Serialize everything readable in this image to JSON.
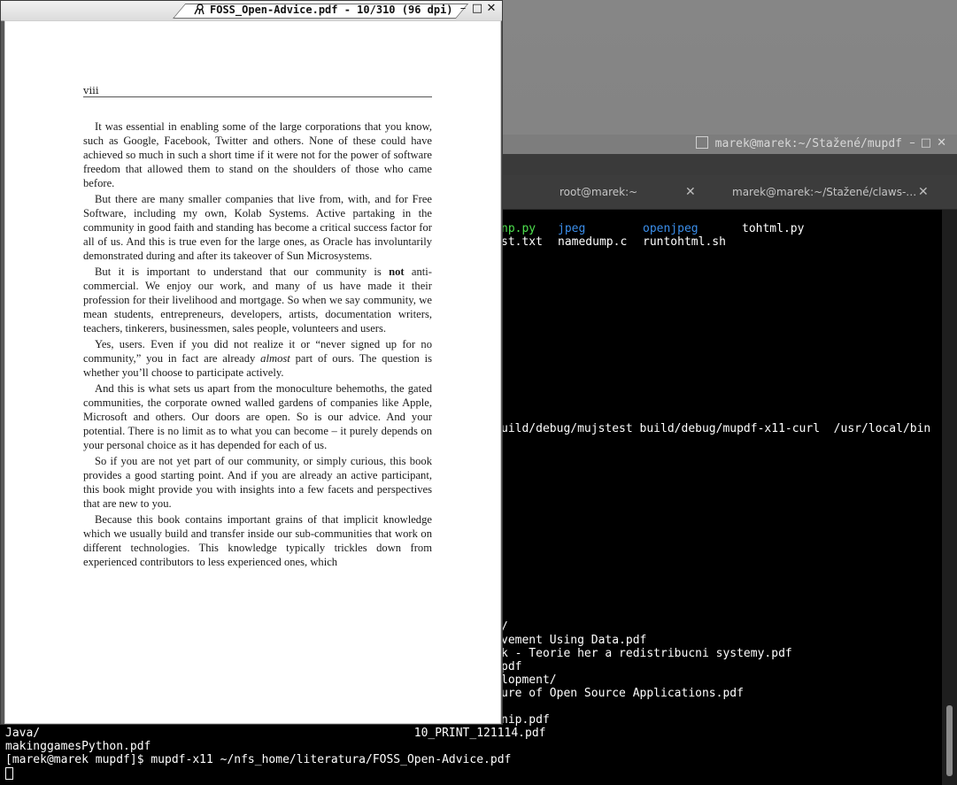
{
  "pdf_viewer": {
    "title": "FOSS_Open-Advice.pdf - 10/310 (96 dpi)",
    "window_buttons": {
      "minimize": "–",
      "maximize": "□",
      "close": "✕"
    },
    "page": {
      "header_number": "viii",
      "paragraphs": [
        [
          "It was essential in enabling some of the large corporations that you know, such as Google, Facebook, Twitter and others. None of these could have achieved so much in such a short time if it were not for the power of software freedom that allowed them to stand on the shoulders of those who came before."
        ],
        [
          "But there are many smaller companies that live from, with, and for Free Software, including my own, Kolab Systems. Active partaking in the community in good faith and standing has become a critical success factor for all of us. And this is true even for the large ones, as Oracle has involuntarily demonstrated during and after its takeover of Sun Microsystems."
        ],
        [
          "But it is important to understand that our community is ",
          "not",
          " anti-commercial. We enjoy our work, and many of us have made it their profession for their livelihood and mortgage. So when we say community, we mean students, entrepreneurs, developers, artists, documentation writers, teachers, tinkerers, businessmen, sales people, volunteers and users."
        ],
        [
          "Yes, users. Even if you did not realize it or “never signed up for no community,” you in fact are already ",
          "almost",
          " part of ours. The question is whether you’ll choose to participate actively."
        ],
        [
          "And this is what sets us apart from the monoculture behemoths, the gated communities, the corporate owned walled gardens of companies like Apple, Microsoft and others. Our doors are open. So is our advice. And your potential. There is no limit as to what you can become – it purely depends on your personal choice as it has depended for each of us."
        ],
        [
          "So if you are not yet part of our community, or simply curious, this book provides a good starting point. And if you are already an active participant, this book might provide you with insights into a few facets and perspectives that are new to you."
        ],
        [
          "Because this book contains important grains of that implicit knowledge which we usually build and transfer inside our sub-communities that work on different technologies. This knowledge typically trickles down from experienced contributors to less experienced ones, which"
        ]
      ]
    }
  },
  "terminal": {
    "title": "marek@marek:~/Stažené/mupdf",
    "window_buttons": {
      "minimize": "–",
      "maximize": "□",
      "close": "✕"
    },
    "tabs": [
      {
        "label": "root@marek:~",
        "close": "✕"
      },
      {
        "label": "marek@marek:~/Stažené/claws-…",
        "close": "✕"
      }
    ],
    "listing_row1": [
      {
        "text": "np.py",
        "color": "green"
      },
      {
        "text": "jpeg",
        "color": "blue"
      },
      {
        "text": "openjpeg",
        "color": "blue"
      },
      {
        "text": "tohtml.py",
        "color": "white"
      }
    ],
    "listing_row2": [
      {
        "text": "st.txt",
        "color": "white"
      },
      {
        "text": "namedump.c",
        "color": "white"
      },
      {
        "text": "runtohtml.sh",
        "color": "white"
      }
    ],
    "lines_right": [
      "uild/debug/mujstest build/debug/mupdf-x11-curl  /usr/local/bin",
      "/",
      "vement Using Data.pdf",
      "k - Teorie her a redistribucni systemy.pdf",
      "pdf",
      "lopment/",
      "ure of Open Source Applications.pdf",
      "nip.pdf"
    ],
    "lines_full": [
      "Java/                                                      10_PRINT_121114.pdf",
      "makinggamesPython.pdf",
      "[marek@marek mupdf]$ mupdf-x11 ~/nfs_home/literatura/FOSS_Open-Advice.pdf"
    ]
  },
  "colors": {
    "terminal_bg": "#000000",
    "listing_green": "#4ee24e",
    "listing_blue": "#3b8eea",
    "titlebar_active": "#e6e6e6",
    "titlebar_inactive": "#7d7d7d"
  }
}
